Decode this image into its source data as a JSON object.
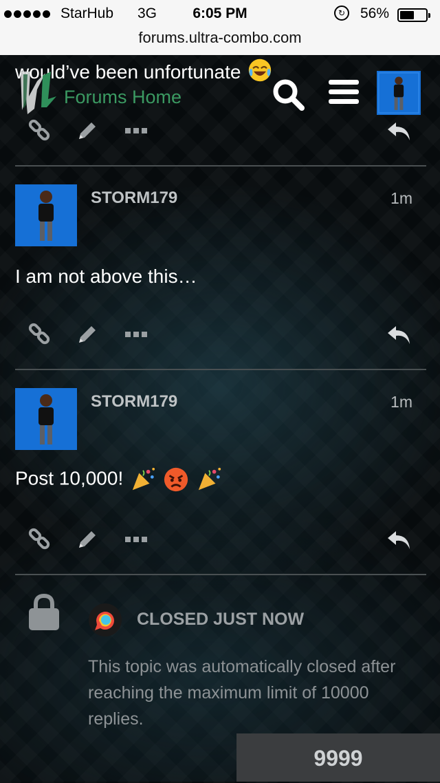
{
  "status_bar": {
    "carrier": "StarHub",
    "network": "3G",
    "time": "6:05 PM",
    "battery_percent": "56%",
    "battery_level": 0.56,
    "url": "forums.ultra-combo.com"
  },
  "header": {
    "previous_post_tail": "would’ve been unfortunate",
    "logo_text": "KI",
    "home_link": "Forums Home",
    "icons": [
      "search-icon",
      "menu-icon",
      "user-avatar"
    ]
  },
  "posts": [
    {
      "username": "STORM179",
      "time": "1m",
      "body": "I am not above this…"
    },
    {
      "username": "STORM179",
      "time": "1m",
      "body": "Post 10,000!",
      "emojis": [
        "party-popper",
        "angry-face",
        "party-popper"
      ]
    }
  ],
  "post_actions": [
    "link-icon",
    "edit-icon",
    "more-icon",
    "reply-icon"
  ],
  "closed_notice": {
    "label": "CLOSED JUST NOW",
    "text": "This topic was automatically closed after reaching the maximum limit of 10000 replies."
  },
  "progress_counter": "9999",
  "colors": {
    "background": "#070b0d",
    "forums_home_green": "#3b9a62",
    "avatar_blue": "#1670d6",
    "divider": "#4a5052"
  }
}
